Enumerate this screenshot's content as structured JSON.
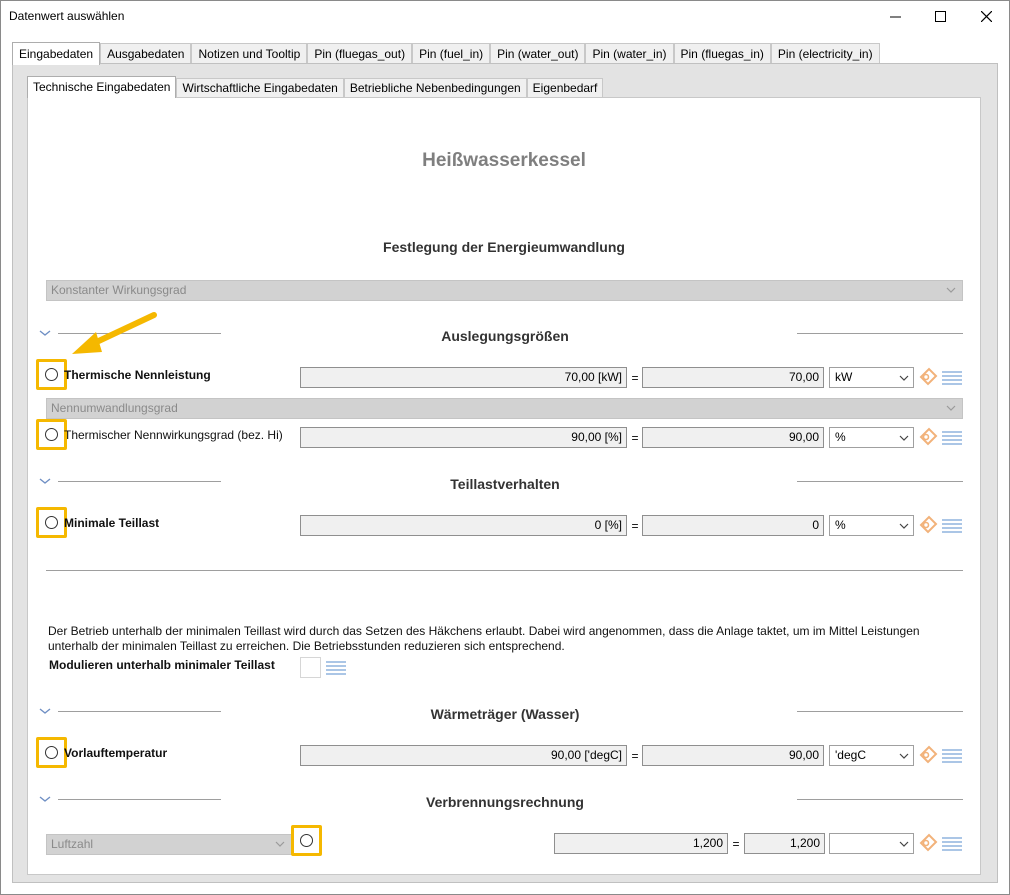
{
  "window": {
    "title": "Datenwert auswählen"
  },
  "main_tabs": [
    "Eingabedaten",
    "Ausgabedaten",
    "Notizen und Tooltip",
    "Pin (fluegas_out)",
    "Pin (fuel_in)",
    "Pin (water_out)",
    "Pin (water_in)",
    "Pin (fluegas_in)",
    "Pin (electricity_in)"
  ],
  "sub_tabs": [
    "Technische Eingabedaten",
    "Wirtschaftliche Eingabedaten",
    "Betriebliche Nebenbedingungen",
    "Eigenbedarf"
  ],
  "component_title": "Heißwasserkessel",
  "energy_section": {
    "title": "Festlegung der Energieumwandlung",
    "mode": "Konstanter Wirkungsgrad"
  },
  "sizing_section": {
    "title": "Auslegungsgrößen",
    "nominal_power": {
      "label": "Thermische Nennleistung",
      "display": "70,00 [kW]",
      "value": "70,00",
      "unit": "kW"
    },
    "efficiency_mode": "Nennumwandlungsgrad",
    "nominal_efficiency": {
      "label": "Thermischer Nennwirkungsgrad (bez. Hi)",
      "display": "90,00 [%]",
      "value": "90,00",
      "unit": "%"
    }
  },
  "partload_section": {
    "title": "Teillastverhalten",
    "min_partload": {
      "label": "Minimale Teillast",
      "display": "0 [%]",
      "value": "0",
      "unit": "%"
    },
    "info_text": "Der Betrieb unterhalb der minimalen Teillast wird durch das Setzen des Häkchens erlaubt. Dabei wird angenommen, dass die Anlage taktet, um im Mittel Leistungen unterhalb der minimalen Teillast zu erreichen. Die Betriebsstunden reduzieren sich entsprechend.",
    "modulate_label": "Modulieren unterhalb minimaler Teillast"
  },
  "carrier_section": {
    "title": "Wärmeträger (Wasser)",
    "flow_temp": {
      "label": "Vorlauftemperatur",
      "display": "90,00 ['degC]",
      "value": "90,00",
      "unit": "'degC"
    }
  },
  "combustion_section": {
    "title": "Verbrennungsrechnung",
    "air_ratio": {
      "mode": "Luftzahl",
      "display": "1,200",
      "value": "1,200",
      "unit": ""
    }
  },
  "colors": {
    "highlight": "#f5b800",
    "arrow": "#f5b800",
    "tag_icon": "#f2b27a",
    "list_icon": "#8fb3de"
  }
}
